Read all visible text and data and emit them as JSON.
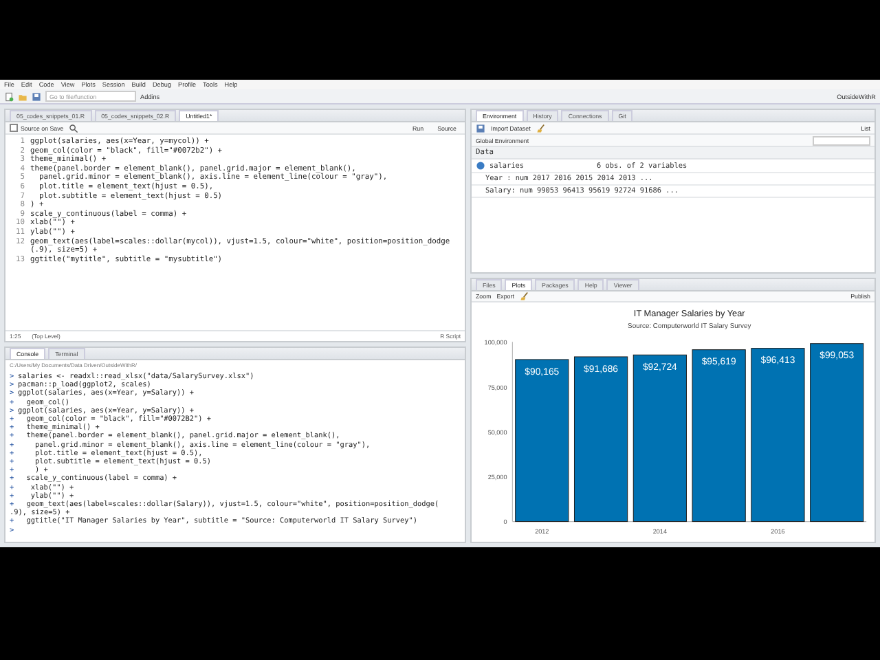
{
  "menu": [
    "File",
    "Edit",
    "Code",
    "View",
    "Plots",
    "Session",
    "Build",
    "Debug",
    "Profile",
    "Tools",
    "Help"
  ],
  "toolbar": {
    "goto_placeholder": "Go to file/function",
    "addins": "Addins",
    "project": "OutsideWithR"
  },
  "editor": {
    "tabs": [
      {
        "label": "05_codes_snippets_01.R",
        "selected": false
      },
      {
        "label": "05_codes_snippets_02.R",
        "selected": false
      },
      {
        "label": "Untitled1*",
        "selected": true
      }
    ],
    "source_on_save": {
      "label": "Source on Save",
      "checked": false
    },
    "run": "Run",
    "source": "Source",
    "lines": [
      {
        "num": "1",
        "text": "ggplot(salaries, aes(x=Year, y=mycol)) +"
      },
      {
        "num": "2",
        "text": "geom_col(color = \"black\", fill=\"#0072b2\") +"
      },
      {
        "num": "3",
        "text": "theme_minimal() +"
      },
      {
        "num": "4",
        "text": "theme(panel.border = element_blank(), panel.grid.major = element_blank(),"
      },
      {
        "num": "5",
        "text": "  panel.grid.minor = element_blank(), axis.line = element_line(colour = \"gray\"),"
      },
      {
        "num": "6",
        "text": "  plot.title = element_text(hjust = 0.5),"
      },
      {
        "num": "7",
        "text": "  plot.subtitle = element_text(hjust = 0.5)"
      },
      {
        "num": "8",
        "text": ") +"
      },
      {
        "num": "9",
        "text": "scale_y_continuous(label = comma) +"
      },
      {
        "num": "10",
        "text": "xlab(\"\") +"
      },
      {
        "num": "11",
        "text": "ylab(\"\") +"
      },
      {
        "num": "12",
        "text": "geom_text(aes(label=scales::dollar(mycol)), vjust=1.5, colour=\"white\", position=position_dodge",
        "wrap": "(.9), size=5) +"
      },
      {
        "num": "13",
        "text": "ggtitle(\"mytitle\", subtitle = \"mysubtitle\")"
      }
    ],
    "status": {
      "position": "1:25",
      "scope": "(Top Level)",
      "type": "R Script"
    }
  },
  "console": {
    "tabs": [
      {
        "label": "Console",
        "selected": true
      },
      {
        "label": "Terminal",
        "selected": false
      }
    ],
    "path": "C:/Users/My Documents/Data Driven/OutsideWithR/",
    "lines": [
      {
        "prompt": ">",
        "text": "salaries <- readxl::read_xlsx(\"data/SalarySurvey.xlsx\")"
      },
      {
        "prompt": ">",
        "text": "pacman::p_load(ggplot2, scales)"
      },
      {
        "prompt": ">",
        "text": "ggplot(salaries, aes(x=Year, y=Salary)) +"
      },
      {
        "prompt": "+",
        "text": "  geom_col()"
      },
      {
        "prompt": ">",
        "text": "ggplot(salaries, aes(x=Year, y=Salary)) +"
      },
      {
        "prompt": "+",
        "text": "  geom_col(color = \"black\", fill=\"#0072B2\") +"
      },
      {
        "prompt": "+",
        "text": "  theme_minimal() +"
      },
      {
        "prompt": "+",
        "text": "  theme(panel.border = element_blank(), panel.grid.major = element_blank(),"
      },
      {
        "prompt": "+",
        "text": "    panel.grid.minor = element_blank(), axis.line = element_line(colour = \"gray\"),"
      },
      {
        "prompt": "+",
        "text": "    plot.title = element_text(hjust = 0.5),"
      },
      {
        "prompt": "+",
        "text": "    plot.subtitle = element_text(hjust = 0.5)"
      },
      {
        "prompt": "+",
        "text": "    ) +"
      },
      {
        "prompt": "+",
        "text": "  scale_y_continuous(label = comma) +"
      },
      {
        "prompt": "+",
        "text": "   xlab(\"\") +"
      },
      {
        "prompt": "+",
        "text": "   ylab(\"\") +"
      },
      {
        "prompt": "+",
        "text": "  geom_text(aes(label=scales::dollar(Salary)), vjust=1.5, colour=\"white\", position=position_dodge("
      },
      {
        "text": ".9), size=5) +"
      },
      {
        "prompt": "+",
        "text": "  ggtitle(\"IT Manager Salaries by Year\", subtitle = \"Source: Computerworld IT Salary Survey\")"
      },
      {
        "prompt": ">"
      }
    ]
  },
  "environment": {
    "tabs": [
      {
        "label": "Environment",
        "selected": true
      },
      {
        "label": "History",
        "selected": false
      },
      {
        "label": "Connections",
        "selected": false
      },
      {
        "label": "Git",
        "selected": false
      }
    ],
    "import": "Import Dataset",
    "view": "List",
    "scope": "Global Environment",
    "section": "Data",
    "object": {
      "name": "salaries",
      "summary": "6 obs. of 2 variables",
      "fields": [
        "Year : num 2017 2016 2015 2014 2013 ...",
        "Salary: num 99053 96413 95619 92724 91686 ..."
      ]
    }
  },
  "plots": {
    "tabs": [
      {
        "label": "Files",
        "selected": false
      },
      {
        "label": "Plots",
        "selected": true
      },
      {
        "label": "Packages",
        "selected": false
      },
      {
        "label": "Help",
        "selected": false
      },
      {
        "label": "Viewer",
        "selected": false
      }
    ],
    "zoom": "Zoom",
    "export": "Export",
    "publish": "Publish",
    "subtitle": "Source: Computerworld IT Salary Survey",
    "chart_data": {
      "type": "bar",
      "title": "IT Manager Salaries by Year",
      "x": [
        2012,
        2013,
        2014,
        2015,
        2016,
        2017
      ],
      "series": [
        {
          "color": "#0072b2",
          "values": [
            90165,
            91686,
            92724,
            95619,
            96413,
            99053
          ]
        }
      ],
      "xlim": [
        2011.5,
        2017.5
      ],
      "ylim": [
        0,
        100000
      ],
      "yticks": [
        {
          "value": 0,
          "label": "0"
        },
        {
          "value": 25000,
          "label": "25,000"
        },
        {
          "value": 50000,
          "label": "50,000"
        },
        {
          "value": 75000,
          "label": "75,000"
        },
        {
          "value": 100000,
          "label": "100,000"
        }
      ],
      "xticks": [
        2012,
        2014,
        2016
      ],
      "value_labels": [
        "$90,165",
        "$91,686",
        "$92,724",
        "$95,619",
        "$96,413",
        "$99,053"
      ]
    }
  }
}
